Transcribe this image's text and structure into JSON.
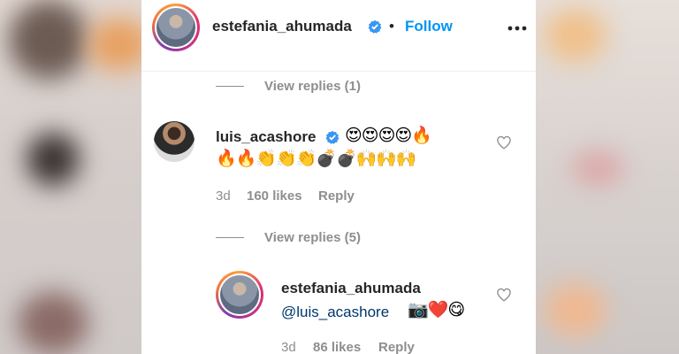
{
  "post_header": {
    "username": "estefania_ahumada",
    "separator": "•",
    "follow_label": "Follow",
    "more_icon": "more-options-icon"
  },
  "replies_toggle_1": {
    "label": "View replies (1)"
  },
  "comment_1": {
    "username": "luis_acashore",
    "emoji_line_1": "😍😍😍😍🔥",
    "emoji_line_2": "🔥🔥👏👏👏💣💣🙌🙌🙌",
    "time": "3d",
    "likes": "160 likes",
    "reply_label": "Reply"
  },
  "replies_toggle_2": {
    "label": "View replies (5)"
  },
  "reply_1": {
    "username": "estefania_ahumada",
    "mention": "@luis_acashore",
    "emojis": "📷❤️😋",
    "time": "3d",
    "likes": "86 likes",
    "reply_label": "Reply"
  },
  "colors": {
    "accent_blue": "#0095f6",
    "mention_blue": "#00376b",
    "text_primary": "#262626",
    "text_secondary": "#8e8e8e"
  }
}
